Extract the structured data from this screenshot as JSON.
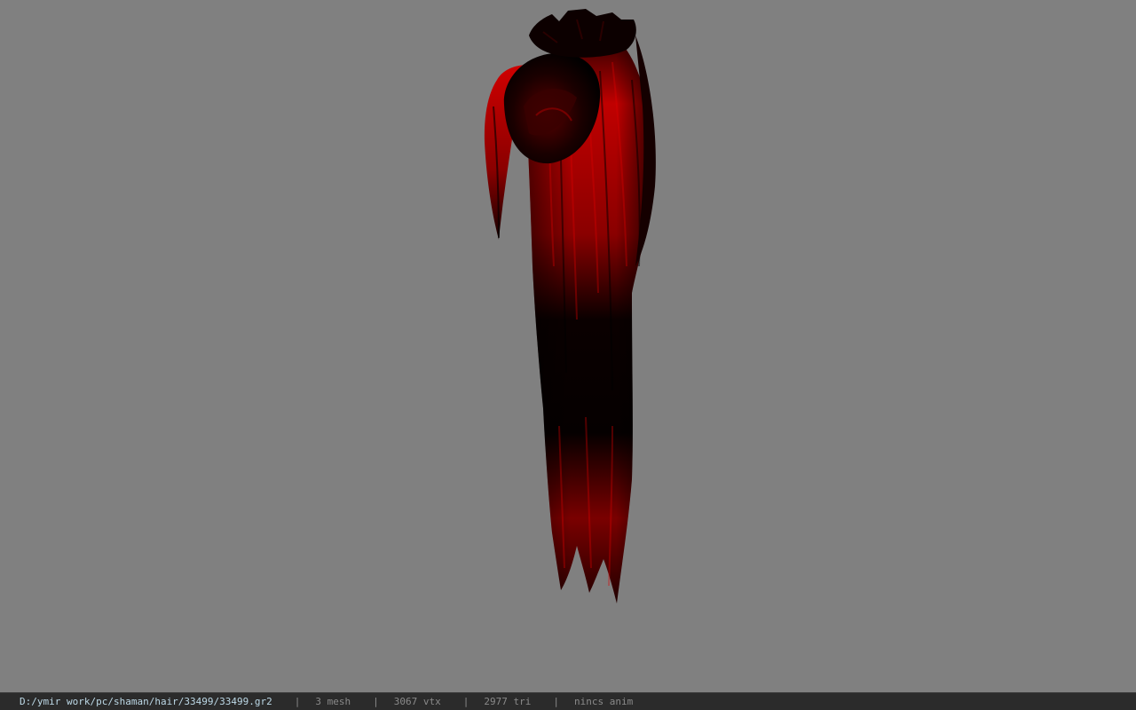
{
  "viewport": {
    "background_color": "#808080",
    "model": {
      "subject": "red hair mesh",
      "primary_color": "#b00000",
      "shadow_color": "#000000"
    }
  },
  "status_bar": {
    "file_path": "D:/ymir work/pc/shaman/hair/33499/33499.gr2",
    "separator": "|",
    "mesh_count": "3 mesh",
    "vertex_count": "3067 vtx",
    "triangle_count": "2977 tri",
    "anim_status": "nincs anim",
    "path_color": "#bcd8e6",
    "text_color": "#8a8a8a",
    "background_color": "#2b2b2b"
  }
}
